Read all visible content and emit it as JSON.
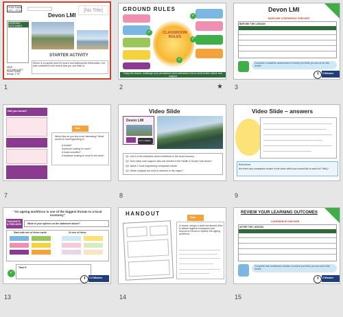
{
  "slides": [
    {
      "number": "1",
      "title": "Devon LMI",
      "badge": "[No Title]",
      "logo_text": "CORE THEME UNIT + TITLE",
      "objectives_heading": "LEARNING OUTCOMES",
      "starter_label": "STARTER ACTIVITY",
      "description": "Devon is a popular area for beach and watersports enthusiasts. List jobs contained to the beach that you can think of.",
      "keywords_heading": "NEW VOCABULARY",
      "keywords": "Rural, Lusby, Bridge, FTE"
    },
    {
      "number": "2",
      "title": "GROUND RULES",
      "subtitle": "CLASSROOM RULES",
      "footer": "Enjoy the lesson, challenge your perceptions and understand how to seek further advice and support"
    },
    {
      "number": "3",
      "title": "Devon LMI",
      "subtitle": "BASELINE CONFIDENCE CHECKER",
      "table_label": "BEFORE THE LESSON",
      "note": "Complete a baseline assessment of where you think you are at for this lesson",
      "timer": "2 Minutes"
    },
    {
      "number": "7",
      "title": "Did you know?",
      "task_label": "Task",
      "task_text": "Which fact do you find most interesting? What would be most appealing to:",
      "bullets": [
        "A tourist?",
        "Someone looking for work?",
        "A local councillor?",
        "A business looking to move to the area?"
      ]
    },
    {
      "number": "8",
      "title": "Video Slide",
      "card_title": "Devon LMI",
      "play_label": "PLAY VIDEO",
      "timer": "3 Minutes",
      "questions": [
        "Q1. List 5 of the industries which contribute to the local economy.",
        "Q2. How many care support roles are needed in the Health & Social Care sector?",
        "Q3. Name 2 local engineering companies shown",
        "Q4. Which subjects are most in demand in the region?"
      ]
    },
    {
      "number": "9",
      "title": "Video Slide – answers",
      "extension": "Extension:",
      "extension_text": "Are there any companies shown in the video which you would like to work for? Why?"
    },
    {
      "number": "13",
      "title": "\"An ageing workforce is one of the biggest threats to a local economy\"",
      "thoughts": "THOUGHTS & FEELINGS",
      "question": "What is your opinion on the statement above?",
      "left_col": "Start with one of these cards",
      "right_col": "Or one of these",
      "task": "Task 5:",
      "timer": "2-3 Minutes"
    },
    {
      "number": "14",
      "title": "HANDOUT",
      "task_label": "Task",
      "task_text": "In teams, design a draft recruitment drive to attract regional employees and beyond to Devon to replace the ageing workforce."
    },
    {
      "number": "15",
      "title": "REVIEW YOUR LEARNING OUTCOMES",
      "subtitle": "CONFIDENCE CHECKER",
      "table_label": "AFTER THE LESSON",
      "note": "Complete this confidence checker of where you think you are at for this lesson",
      "timer": "2 Minutes"
    }
  ],
  "colors": {
    "selected_border": "#c8412f",
    "accent_green": "#2f6b3a",
    "bright_green": "#3fae49",
    "accent_purple": "#8a3b8f",
    "accent_blue": "#2a6fb5",
    "accent_yellow": "#f3d23c"
  }
}
